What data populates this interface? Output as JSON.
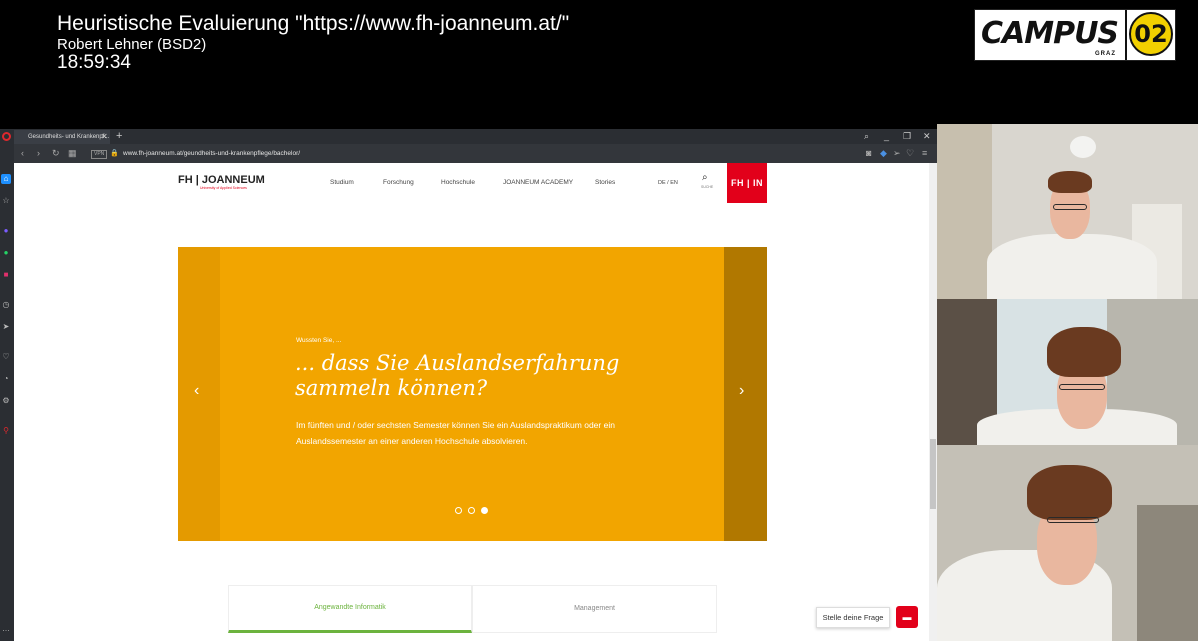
{
  "overlay": {
    "title": "Heuristische Evaluierung \"https://www.fh-joanneum.at/\"",
    "presenter": "Robert Lehner (BSD2)",
    "time": "18:59:34"
  },
  "logo": {
    "campus": "CAMPUS",
    "graz": "GRAZ",
    "number": "02"
  },
  "browser": {
    "tab_title": "Gesundheits- und Krankenpf...",
    "url": "www.fh-joanneum.at/geundheits-und-krankenpflege/bachelor/",
    "vpn": "VPN"
  },
  "site": {
    "logo": "FH | JOANNEUM",
    "logo_sub": "University of Applied Sciences",
    "nav": [
      "Studium",
      "Forschung",
      "Hochschule",
      "JOANNEUM ACADEMY",
      "Stories"
    ],
    "lang": "DE / EN",
    "search_label": "SUCHE",
    "fhin": "FH | IN"
  },
  "hero": {
    "kicker": "Wussten Sie, ...",
    "headline": "... dass Sie Auslandserfahrung sammeln können?",
    "body": "Im fünften und / oder sechsten Semester können Sie ein Auslandspraktikum oder ein Auslandssemester an einer anderen Hochschule absolvieren.",
    "slide_count": 3,
    "active_slide": 3
  },
  "tabs": [
    "Angewandte Informatik",
    "Management"
  ],
  "chat": {
    "label": "Stelle deine Frage"
  },
  "colors": {
    "hero": "#f2a500",
    "brand_red": "#e2001a",
    "accent_green": "#6cb33e"
  }
}
